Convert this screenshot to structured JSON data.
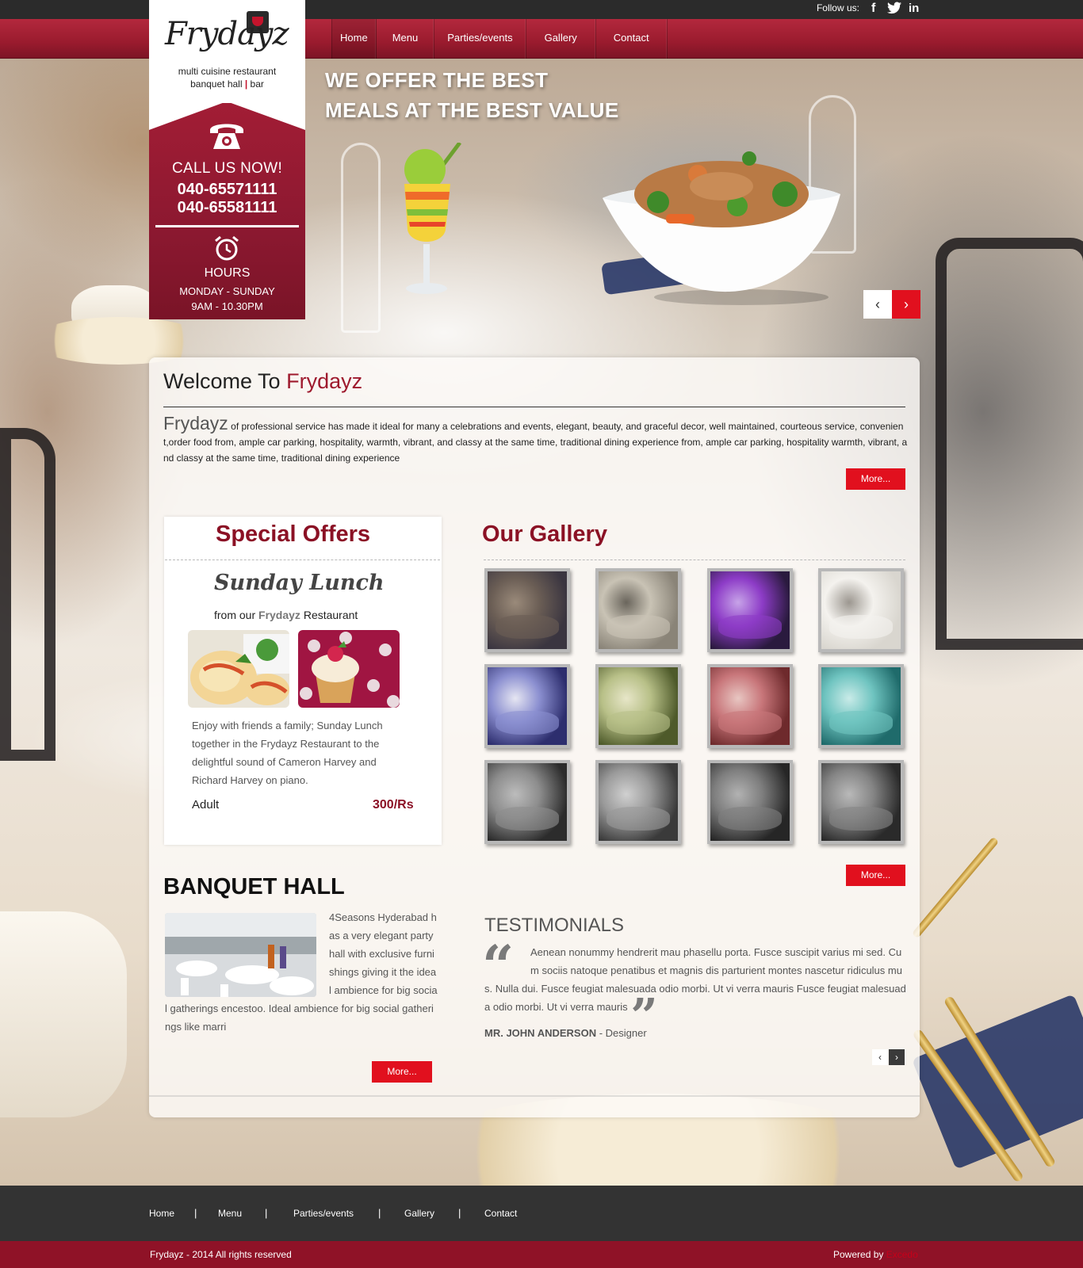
{
  "topbar": {
    "follow_label": "Follow us:",
    "social": [
      "facebook-icon",
      "twitter-icon",
      "linkedin-icon"
    ],
    "social_glyphs": [
      "f",
      "t",
      "in"
    ]
  },
  "nav": {
    "items": [
      "Home",
      "Menu",
      "Parties/events",
      "Gallery",
      "Contact"
    ]
  },
  "logo": {
    "name": "Frydayz",
    "tagline_1": "multi cuisine restaurant",
    "tagline_2a": "banquet hall",
    "tagline_sep": "|",
    "tagline_2b": "bar"
  },
  "call": {
    "title": "CALL US NOW!",
    "phone_1": "040-65571111",
    "phone_2": "040-65581111"
  },
  "hours": {
    "title": "HOURS",
    "days": "MONDAY - SUNDAY",
    "time": "9AM - 10.30PM"
  },
  "hero": {
    "line_1": "WE OFFER THE BEST",
    "line_2": "MEALS AT THE BEST VALUE",
    "prev": "‹",
    "next": "›"
  },
  "welcome": {
    "heading_prefix": "Welcome To",
    "heading_brand": "Frydayz",
    "lead": "Frydayz",
    "body": "of professional service has made it ideal for many a celebrations and events, elegant, beauty, and graceful decor, well maintained, courteous service, convenient,order food from, ample car parking, hospitality, warmth, vibrant, and classy at the same time, traditional dining experience from, ample car parking, hospitality warmth, vibrant, and classy at the same time, traditional dining experience",
    "more": "More..."
  },
  "offers": {
    "heading": "Special Offers",
    "script_title": "Sunday Lunch",
    "from_prefix": "from our",
    "from_brand": "Frydayz",
    "from_suffix": "Restaurant",
    "description": "Enjoy with friends a family; Sunday Lunch together in the Frydayz  Restaurant to the delightful sound of Cameron Harvey and Richard Harvey on piano.",
    "price_label": "Adult",
    "price": "300/Rs"
  },
  "gallery": {
    "heading": "Our Gallery",
    "more": "More...",
    "items": [
      {
        "name": "restaurant-interior-photo",
        "colors": [
          "#3a3540",
          "#6b5e55",
          "#9a8a7a"
        ]
      },
      {
        "name": "spoons-photo",
        "colors": [
          "#8a8478",
          "#c9c3b5",
          "#6a655c"
        ]
      },
      {
        "name": "purple-lounge-photo",
        "colors": [
          "#2a1a3e",
          "#8d3cc7",
          "#c7a3e8"
        ]
      },
      {
        "name": "banquet-tables-photo",
        "colors": [
          "#d9d6cf",
          "#f4f2ee",
          "#9c9790"
        ]
      },
      {
        "name": "blue-food-photo",
        "colors": [
          "#2d2e6e",
          "#8b8fd0",
          "#e6e6f2"
        ]
      },
      {
        "name": "green-salad-photo",
        "colors": [
          "#4e5a2a",
          "#b8c088",
          "#e7e6c8"
        ]
      },
      {
        "name": "red-bowl-photo",
        "colors": [
          "#6e2a2c",
          "#c8767a",
          "#e8c6c2"
        ]
      },
      {
        "name": "teal-bowl-photo",
        "colors": [
          "#1f6b6b",
          "#6fc4c0",
          "#c9ebe8"
        ]
      },
      {
        "name": "grilled-skewers-photo",
        "colors": [
          "#2c2c2c",
          "#8d8d8d",
          "#bcbcbc"
        ]
      },
      {
        "name": "curry-bowl-photo",
        "colors": [
          "#3a3a3a",
          "#9a9a9a",
          "#d0d0d0"
        ]
      },
      {
        "name": "grill-platter-photo-1",
        "colors": [
          "#262626",
          "#7e7e7e",
          "#b2b2b2"
        ]
      },
      {
        "name": "grill-platter-photo-2",
        "colors": [
          "#2a2a2a",
          "#858585",
          "#b9b9b9"
        ]
      }
    ]
  },
  "banquet": {
    "heading": "BANQUET HALL",
    "text": "4Seasons Hyderabad has a very elegant party hall with exclusive furnishings giving it the ideal ambience for big social gatherings encestoo. Ideal ambience for big social gatherings like marri",
    "more": "More..."
  },
  "testimonials": {
    "heading": "TESTIMONIALS",
    "open_quote": "“",
    "close_quote": "”",
    "text": "Aenean nonummy hendrerit mau phasellu porta. Fusce suscipit varius  mi sed. Cum sociis natoque penatibus et magnis dis parturient montes nascetur ridiculus mus. Nulla dui. Fusce feugiat malesuada odio morbi. Ut vi verra mauris Fusce feugiat malesuada odio morbi. Ut vi verra mauris",
    "author": "MR. JOHN ANDERSON",
    "role": "- Designer",
    "prev": "‹",
    "next": "›"
  },
  "footer": {
    "nav": [
      "Home",
      "Menu",
      "Parties/events",
      "Gallery",
      "Contact"
    ],
    "separator": "|",
    "copyright": "Frydayz  - 2014 All rights reserved",
    "powered_prefix": "Powered by",
    "powered_brand": "Excedo"
  },
  "colors": {
    "brand_red": "#9e1a2e",
    "button_red": "#e1101e",
    "footer_dark": "#333333",
    "footer_red": "#8f1227"
  }
}
